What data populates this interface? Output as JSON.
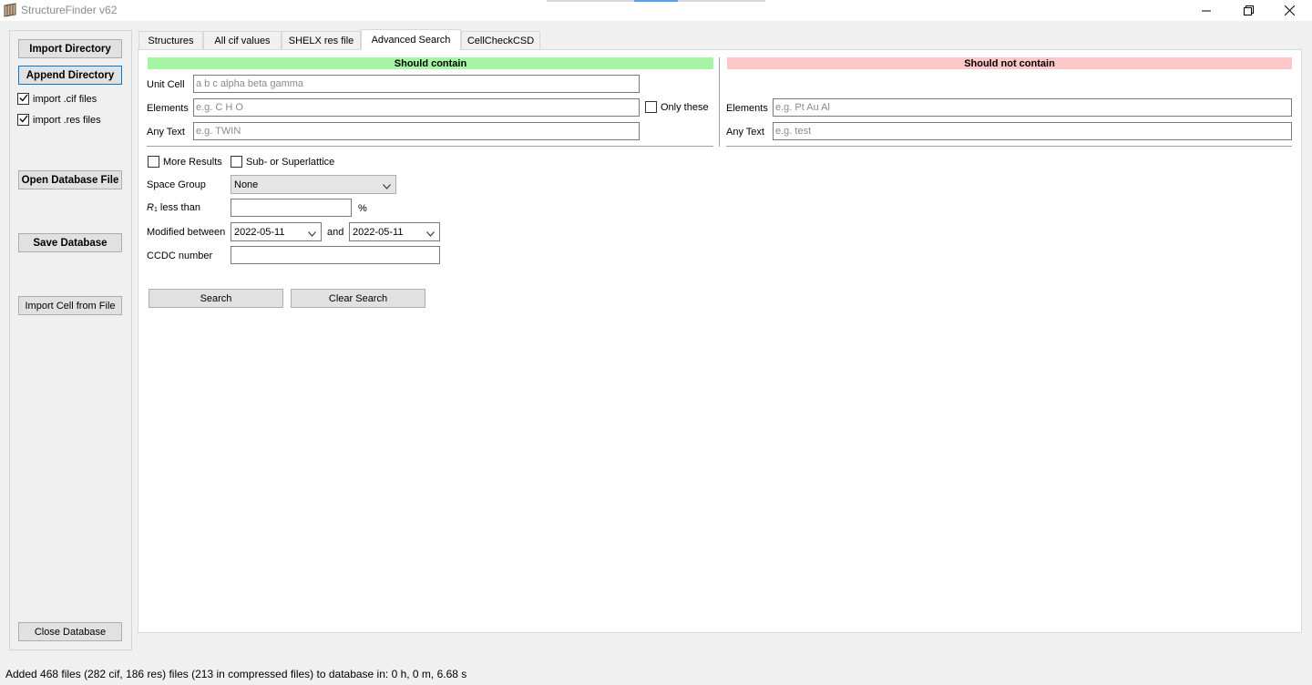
{
  "window": {
    "title": "StructureFinder v62"
  },
  "sidebar": {
    "import_directory": "Import Directory",
    "append_directory": "Append Directory",
    "import_cif_label": "import .cif files",
    "import_cif_checked": true,
    "import_res_label": "import .res files",
    "import_res_checked": true,
    "open_database": "Open Database File",
    "save_database": "Save Database",
    "import_cell": "Import Cell from File",
    "close_database": "Close Database"
  },
  "tabs": [
    {
      "label": "Structures",
      "active": false
    },
    {
      "label": "All cif values",
      "active": false
    },
    {
      "label": "SHELX res file",
      "active": false
    },
    {
      "label": "Advanced Search",
      "active": true
    },
    {
      "label": "CellCheckCSD",
      "active": false
    }
  ],
  "advanced": {
    "should_contain": "Should contain",
    "should_not_contain": "Should not contain",
    "unit_cell_label": "Unit Cell",
    "unit_cell_placeholder": "a b c alpha beta gamma",
    "elements_label": "Elements",
    "elements_placeholder": "e.g. C H O",
    "only_these_label": "Only these",
    "only_these_checked": false,
    "any_text_label": "Any Text",
    "any_text_placeholder": "e.g. TWIN",
    "not_elements_label": "Elements",
    "not_elements_placeholder": "e.g. Pt Au Al",
    "not_any_text_label": "Any Text",
    "not_any_text_placeholder": "e.g. test",
    "more_results_label": "More Results",
    "more_results_checked": false,
    "superlattice_label": "Sub- or Superlattice",
    "superlattice_checked": false,
    "space_group_label": "Space Group",
    "space_group_value": "None",
    "r1_symbol": "R",
    "r1_subscript": "1",
    "r1_suffix": " less than",
    "r1_value": "",
    "percent": "%",
    "modified_between_label": "Modified between",
    "date_from": "2022-05-11",
    "and_label": "and",
    "date_to": "2022-05-11",
    "ccdc_label": "CCDC number",
    "ccdc_value": "",
    "search_button": "Search",
    "clear_button": "Clear Search"
  },
  "colors": {
    "contain_bg": "#a5f5a5",
    "not_contain_bg": "#ffc8c8",
    "focus_border": "#0078d7"
  },
  "status_bar": "Added 468 files (282 cif, 186 res) files (213 in compressed files) to database in:  0 h,  0 m, 6.68 s",
  "icons": [
    "app-icon",
    "minimize-icon",
    "restore-icon",
    "close-icon",
    "checkmark-icon",
    "chevron-down-icon"
  ]
}
